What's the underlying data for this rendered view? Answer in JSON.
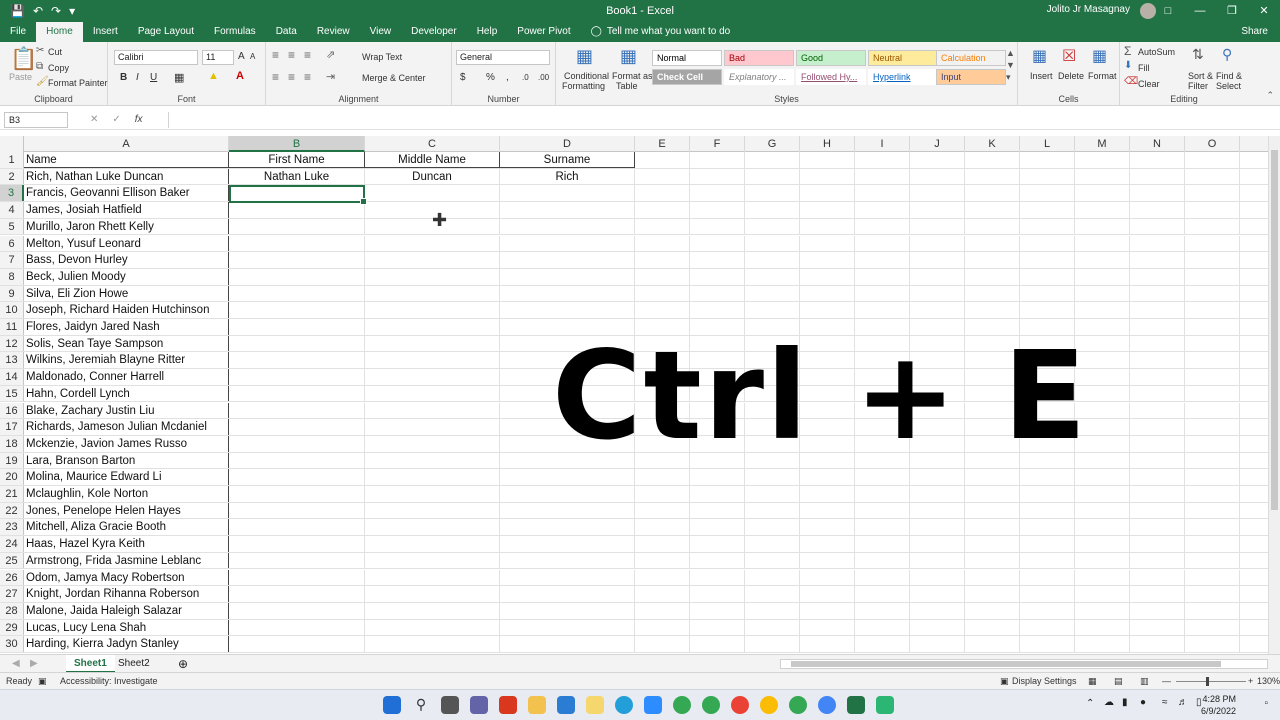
{
  "titlebar": {
    "title": "Book1 - Excel",
    "user": "Jolito Jr Masagnay",
    "qat_icons": [
      "save-icon",
      "undo-icon",
      "redo-icon",
      "customize-icon"
    ]
  },
  "ribbon_tabs": [
    "File",
    "Home",
    "Insert",
    "Page Layout",
    "Formulas",
    "Data",
    "Review",
    "View",
    "Developer",
    "Help",
    "Power Pivot"
  ],
  "active_tab": "Home",
  "tell_me": "Tell me what you want to do",
  "share": "Share",
  "clipboard": {
    "paste": "Paste",
    "cut": "Cut",
    "copy": "Copy",
    "format_painter": "Format Painter",
    "label": "Clipboard"
  },
  "font": {
    "name": "Calibri",
    "size": "11",
    "label": "Font"
  },
  "alignment": {
    "wrap_text": "Wrap Text",
    "merge_center": "Merge & Center",
    "label": "Alignment"
  },
  "number": {
    "format": "General",
    "label": "Number"
  },
  "styles": {
    "conditional": "Conditional",
    "formatting": "Formatting",
    "format_as": "Format as",
    "table": "Table",
    "cells": [
      {
        "name": "Normal",
        "color": "#000000",
        "bg": "#ffffff"
      },
      {
        "name": "Bad",
        "color": "#9c0006",
        "bg": "#ffc7ce"
      },
      {
        "name": "Good",
        "color": "#006100",
        "bg": "#c6efce"
      },
      {
        "name": "Neutral",
        "color": "#9c5700",
        "bg": "#ffeb9c"
      },
      {
        "name": "Calculation",
        "color": "#fa7d00",
        "bg": "#f2f2f2"
      },
      {
        "name": "Check Cell",
        "color": "#ffffff",
        "bg": "#a5a5a5"
      },
      {
        "name": "Explanatory ...",
        "color": "#7f7f7f",
        "bg": "#ffffff"
      },
      {
        "name": "Followed Hy...",
        "color": "#954f72",
        "bg": "#ffffff"
      },
      {
        "name": "Hyperlink",
        "color": "#0563c1",
        "bg": "#ffffff"
      },
      {
        "name": "Input",
        "color": "#3f3f76",
        "bg": "#ffcc99"
      }
    ],
    "label": "Styles"
  },
  "cells_group": {
    "insert": "Insert",
    "delete": "Delete",
    "format": "Format",
    "label": "Cells"
  },
  "editing": {
    "autosum": "AutoSum",
    "fill": "Fill",
    "clear": "Clear",
    "sort_filter_1": "Sort &",
    "sort_filter_2": "Filter",
    "find_select_1": "Find &",
    "find_select_2": "Select",
    "label": "Editing"
  },
  "formula_bar": {
    "name_box": "B3",
    "fx": "fx",
    "content": ""
  },
  "columns": [
    "A",
    "B",
    "C",
    "D",
    "E",
    "F",
    "G",
    "H",
    "I",
    "J",
    "K",
    "L",
    "M",
    "N",
    "O"
  ],
  "selected_column": "B",
  "selected_row": "3",
  "rows": [
    {
      "n": "1",
      "a": "Name",
      "b": "First Name",
      "c": "Middle Name",
      "d": "Surname"
    },
    {
      "n": "2",
      "a": "Rich, Nathan Luke Duncan",
      "b": "Nathan Luke",
      "c": "Duncan",
      "d": "Rich"
    },
    {
      "n": "3",
      "a": "Francis, Geovanni Ellison Baker",
      "b": "",
      "c": "",
      "d": ""
    },
    {
      "n": "4",
      "a": "James,  Josiah Hatfield",
      "b": "",
      "c": "",
      "d": ""
    },
    {
      "n": "5",
      "a": "Murillo, Jaron Rhett Kelly",
      "b": "",
      "c": "",
      "d": ""
    },
    {
      "n": "6",
      "a": "Melton, Yusuf  Leonard",
      "b": "",
      "c": "",
      "d": ""
    },
    {
      "n": "7",
      "a": "Bass, Devon  Hurley",
      "b": "",
      "c": "",
      "d": ""
    },
    {
      "n": "8",
      "a": "Beck, Julien  Moody",
      "b": "",
      "c": "",
      "d": ""
    },
    {
      "n": "9",
      "a": "Silva, Eli Zion Howe",
      "b": "",
      "c": "",
      "d": ""
    },
    {
      "n": "10",
      "a": "Joseph, Richard Haiden Hutchinson",
      "b": "",
      "c": "",
      "d": ""
    },
    {
      "n": "11",
      "a": "Flores, Jaidyn Jared Nash",
      "b": "",
      "c": "",
      "d": ""
    },
    {
      "n": "12",
      "a": "Solis, Sean Taye Sampson",
      "b": "",
      "c": "",
      "d": ""
    },
    {
      "n": "13",
      "a": "Wilkins, Jeremiah Blayne Ritter",
      "b": "",
      "c": "",
      "d": ""
    },
    {
      "n": "14",
      "a": "Maldonado, Conner  Harrell",
      "b": "",
      "c": "",
      "d": ""
    },
    {
      "n": "15",
      "a": "Hahn, Cordell  Lynch",
      "b": "",
      "c": "",
      "d": ""
    },
    {
      "n": "16",
      "a": "Blake, Zachary Justin Liu",
      "b": "",
      "c": "",
      "d": ""
    },
    {
      "n": "17",
      "a": "Richards, Jameson Julian Mcdaniel",
      "b": "",
      "c": "",
      "d": ""
    },
    {
      "n": "18",
      "a": "Mckenzie, Javion James Russo",
      "b": "",
      "c": "",
      "d": ""
    },
    {
      "n": "19",
      "a": "Lara, Branson  Barton",
      "b": "",
      "c": "",
      "d": ""
    },
    {
      "n": "20",
      "a": "Molina, Maurice Edward Li",
      "b": "",
      "c": "",
      "d": ""
    },
    {
      "n": "21",
      "a": "Mclaughlin, Kole  Norton",
      "b": "",
      "c": "",
      "d": ""
    },
    {
      "n": "22",
      "a": "Jones, Penelope Helen Hayes",
      "b": "",
      "c": "",
      "d": ""
    },
    {
      "n": "23",
      "a": "Mitchell, Aliza Gracie Booth",
      "b": "",
      "c": "",
      "d": ""
    },
    {
      "n": "24",
      "a": "Haas, Hazel Kyra Keith",
      "b": "",
      "c": "",
      "d": ""
    },
    {
      "n": "25",
      "a": "Armstrong, Frida Jasmine Leblanc",
      "b": "",
      "c": "",
      "d": ""
    },
    {
      "n": "26",
      "a": "Odom, Jamya Macy Robertson",
      "b": "",
      "c": "",
      "d": ""
    },
    {
      "n": "27",
      "a": "Knight, Jordan Rihanna Roberson",
      "b": "",
      "c": "",
      "d": ""
    },
    {
      "n": "28",
      "a": "Malone, Jaida Haleigh Salazar",
      "b": "",
      "c": "",
      "d": ""
    },
    {
      "n": "29",
      "a": "Lucas, Lucy Lena Shah",
      "b": "",
      "c": "",
      "d": ""
    },
    {
      "n": "30",
      "a": "Harding, Kierra Jadyn Stanley",
      "b": "",
      "c": "",
      "d": ""
    }
  ],
  "overlay_text": "Ctrl + E",
  "sheets": [
    "Sheet1",
    "Sheet2"
  ],
  "active_sheet": "Sheet1",
  "status": {
    "ready": "Ready",
    "accessibility": "Accessibility: Investigate",
    "display_settings": "Display Settings",
    "zoom": "130%"
  },
  "taskbar": {
    "time": "4:28 PM",
    "date": "6/9/2022"
  },
  "accent_color": "#217346"
}
